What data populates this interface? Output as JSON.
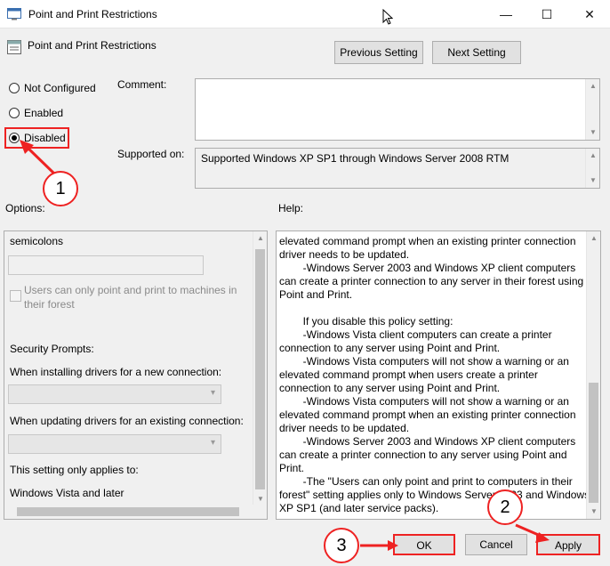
{
  "window": {
    "title": "Point and Print Restrictions",
    "min_glyph": "—",
    "max_glyph": "☐",
    "close_glyph": "✕"
  },
  "header": {
    "title": "Point and Print Restrictions",
    "prev_button": "Previous Setting",
    "next_button": "Next Setting"
  },
  "state_options": [
    {
      "label": "Not Configured",
      "selected": false
    },
    {
      "label": "Enabled",
      "selected": false
    },
    {
      "label": "Disabled",
      "selected": true
    }
  ],
  "comment": {
    "label": "Comment:",
    "value": ""
  },
  "supported_on": {
    "label": "Supported on:",
    "value": "Supported Windows XP SP1 through Windows Server 2008 RTM"
  },
  "options": {
    "label": "Options:",
    "semicolons": "semicolons",
    "checkbox_label": "Users can only point and print to machines in their forest",
    "security_prompts": "Security Prompts:",
    "installing_label": "When installing drivers for a new connection:",
    "updating_label": "When updating drivers for an existing connection:",
    "applies_label": "This setting only applies to:",
    "applies_value": "Windows Vista and later"
  },
  "help": {
    "label": "Help:",
    "lines": [
      "elevated command prompt when an existing printer connection",
      "driver needs to be updated.",
      "        -Windows Server 2003 and Windows XP client computers",
      "can create a printer connection to any server in their forest using",
      "Point and Print.",
      "",
      "        If you disable this policy setting:",
      "        -Windows Vista client computers can create a printer",
      "connection to any server using Point and Print.",
      "        -Windows Vista computers will not show a warning or an",
      "elevated command prompt when users create a printer",
      "connection to any server using Point and Print.",
      "        -Windows Vista computers will not show a warning or an",
      "elevated command prompt when an existing printer connection",
      "driver needs to be updated.",
      "        -Windows Server 2003 and Windows XP client computers",
      "can create a printer connection to any server using Point and",
      "Print.",
      "        -The \"Users can only point and print to computers in their",
      "forest\" setting applies only to Windows Server 2003 and Windows",
      "XP SP1 (and later service packs)."
    ]
  },
  "footer": {
    "ok": "OK",
    "cancel": "Cancel",
    "apply": "Apply"
  },
  "annotations": {
    "badge1": "1",
    "badge2": "2",
    "badge3": "3",
    "color": "#e22222"
  }
}
